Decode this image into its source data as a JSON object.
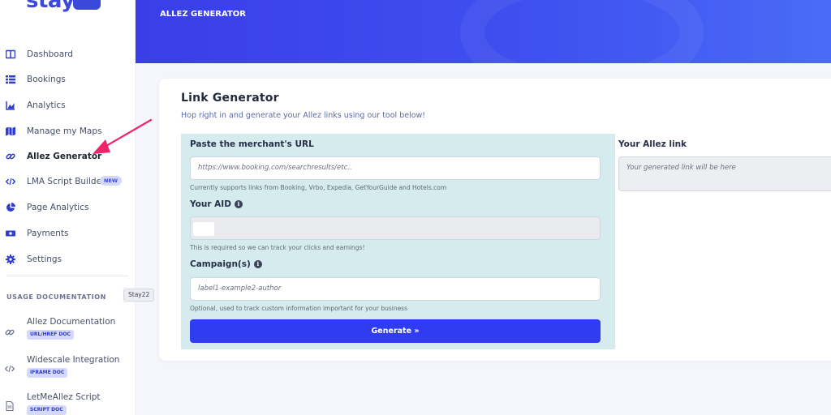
{
  "sidebar": {
    "logo": "stay",
    "items": [
      {
        "label": "Dashboard",
        "icon": "dashboard-icon"
      },
      {
        "label": "Bookings",
        "icon": "list-icon"
      },
      {
        "label": "Analytics",
        "icon": "chart-icon"
      },
      {
        "label": "Manage my Maps",
        "icon": "map-icon"
      },
      {
        "label": "Allez Generator",
        "icon": "link-icon"
      },
      {
        "label": "LMA Script Builder",
        "icon": "code-icon",
        "badge": "NEW"
      },
      {
        "label": "Page Analytics",
        "icon": "pie-chart-icon"
      },
      {
        "label": "Payments",
        "icon": "money-icon"
      },
      {
        "label": "Settings",
        "icon": "gear-icon"
      }
    ],
    "active": "Allez Generator",
    "usage_title": "USAGE DOCUMENTATION",
    "docs": [
      {
        "label": "Allez Documentation",
        "tag": "URL/HREF DOC",
        "icon": "link-icon"
      },
      {
        "label": "Widescale Integration",
        "tag": "IFRAME DOC",
        "icon": "code-icon"
      },
      {
        "label": "LetMeAllez Script",
        "tag": "SCRIPT DOC",
        "icon": "file-icon"
      }
    ],
    "tooltip": "Stay22"
  },
  "header": {
    "title": "ALLEZ GENERATOR"
  },
  "card": {
    "title": "Link Generator",
    "subtitle": "Hop right in and generate your Allez links using our tool below!",
    "merchant": {
      "label": "Paste the merchant's URL",
      "placeholder": "https://www.booking.com/searchresults/etc..",
      "help": "Currently supports links from Booking, Vrbo, Expedia, GetYourGuide and Hotels.com"
    },
    "aid": {
      "label": "Your AID",
      "help": "This is required so we can track your clicks and earnings!"
    },
    "campaign": {
      "label": "Campaign(s)",
      "placeholder": "label1-example2-author",
      "help": "Optional, used to track custom information important for your business"
    },
    "generate_label": "Generate »",
    "output": {
      "label": "Your Allez link",
      "placeholder": "Your generated link will be here"
    }
  },
  "colors": {
    "accent": "#2f3cf2",
    "form_bg": "#d5ebee",
    "arrow": "#f0246b"
  }
}
